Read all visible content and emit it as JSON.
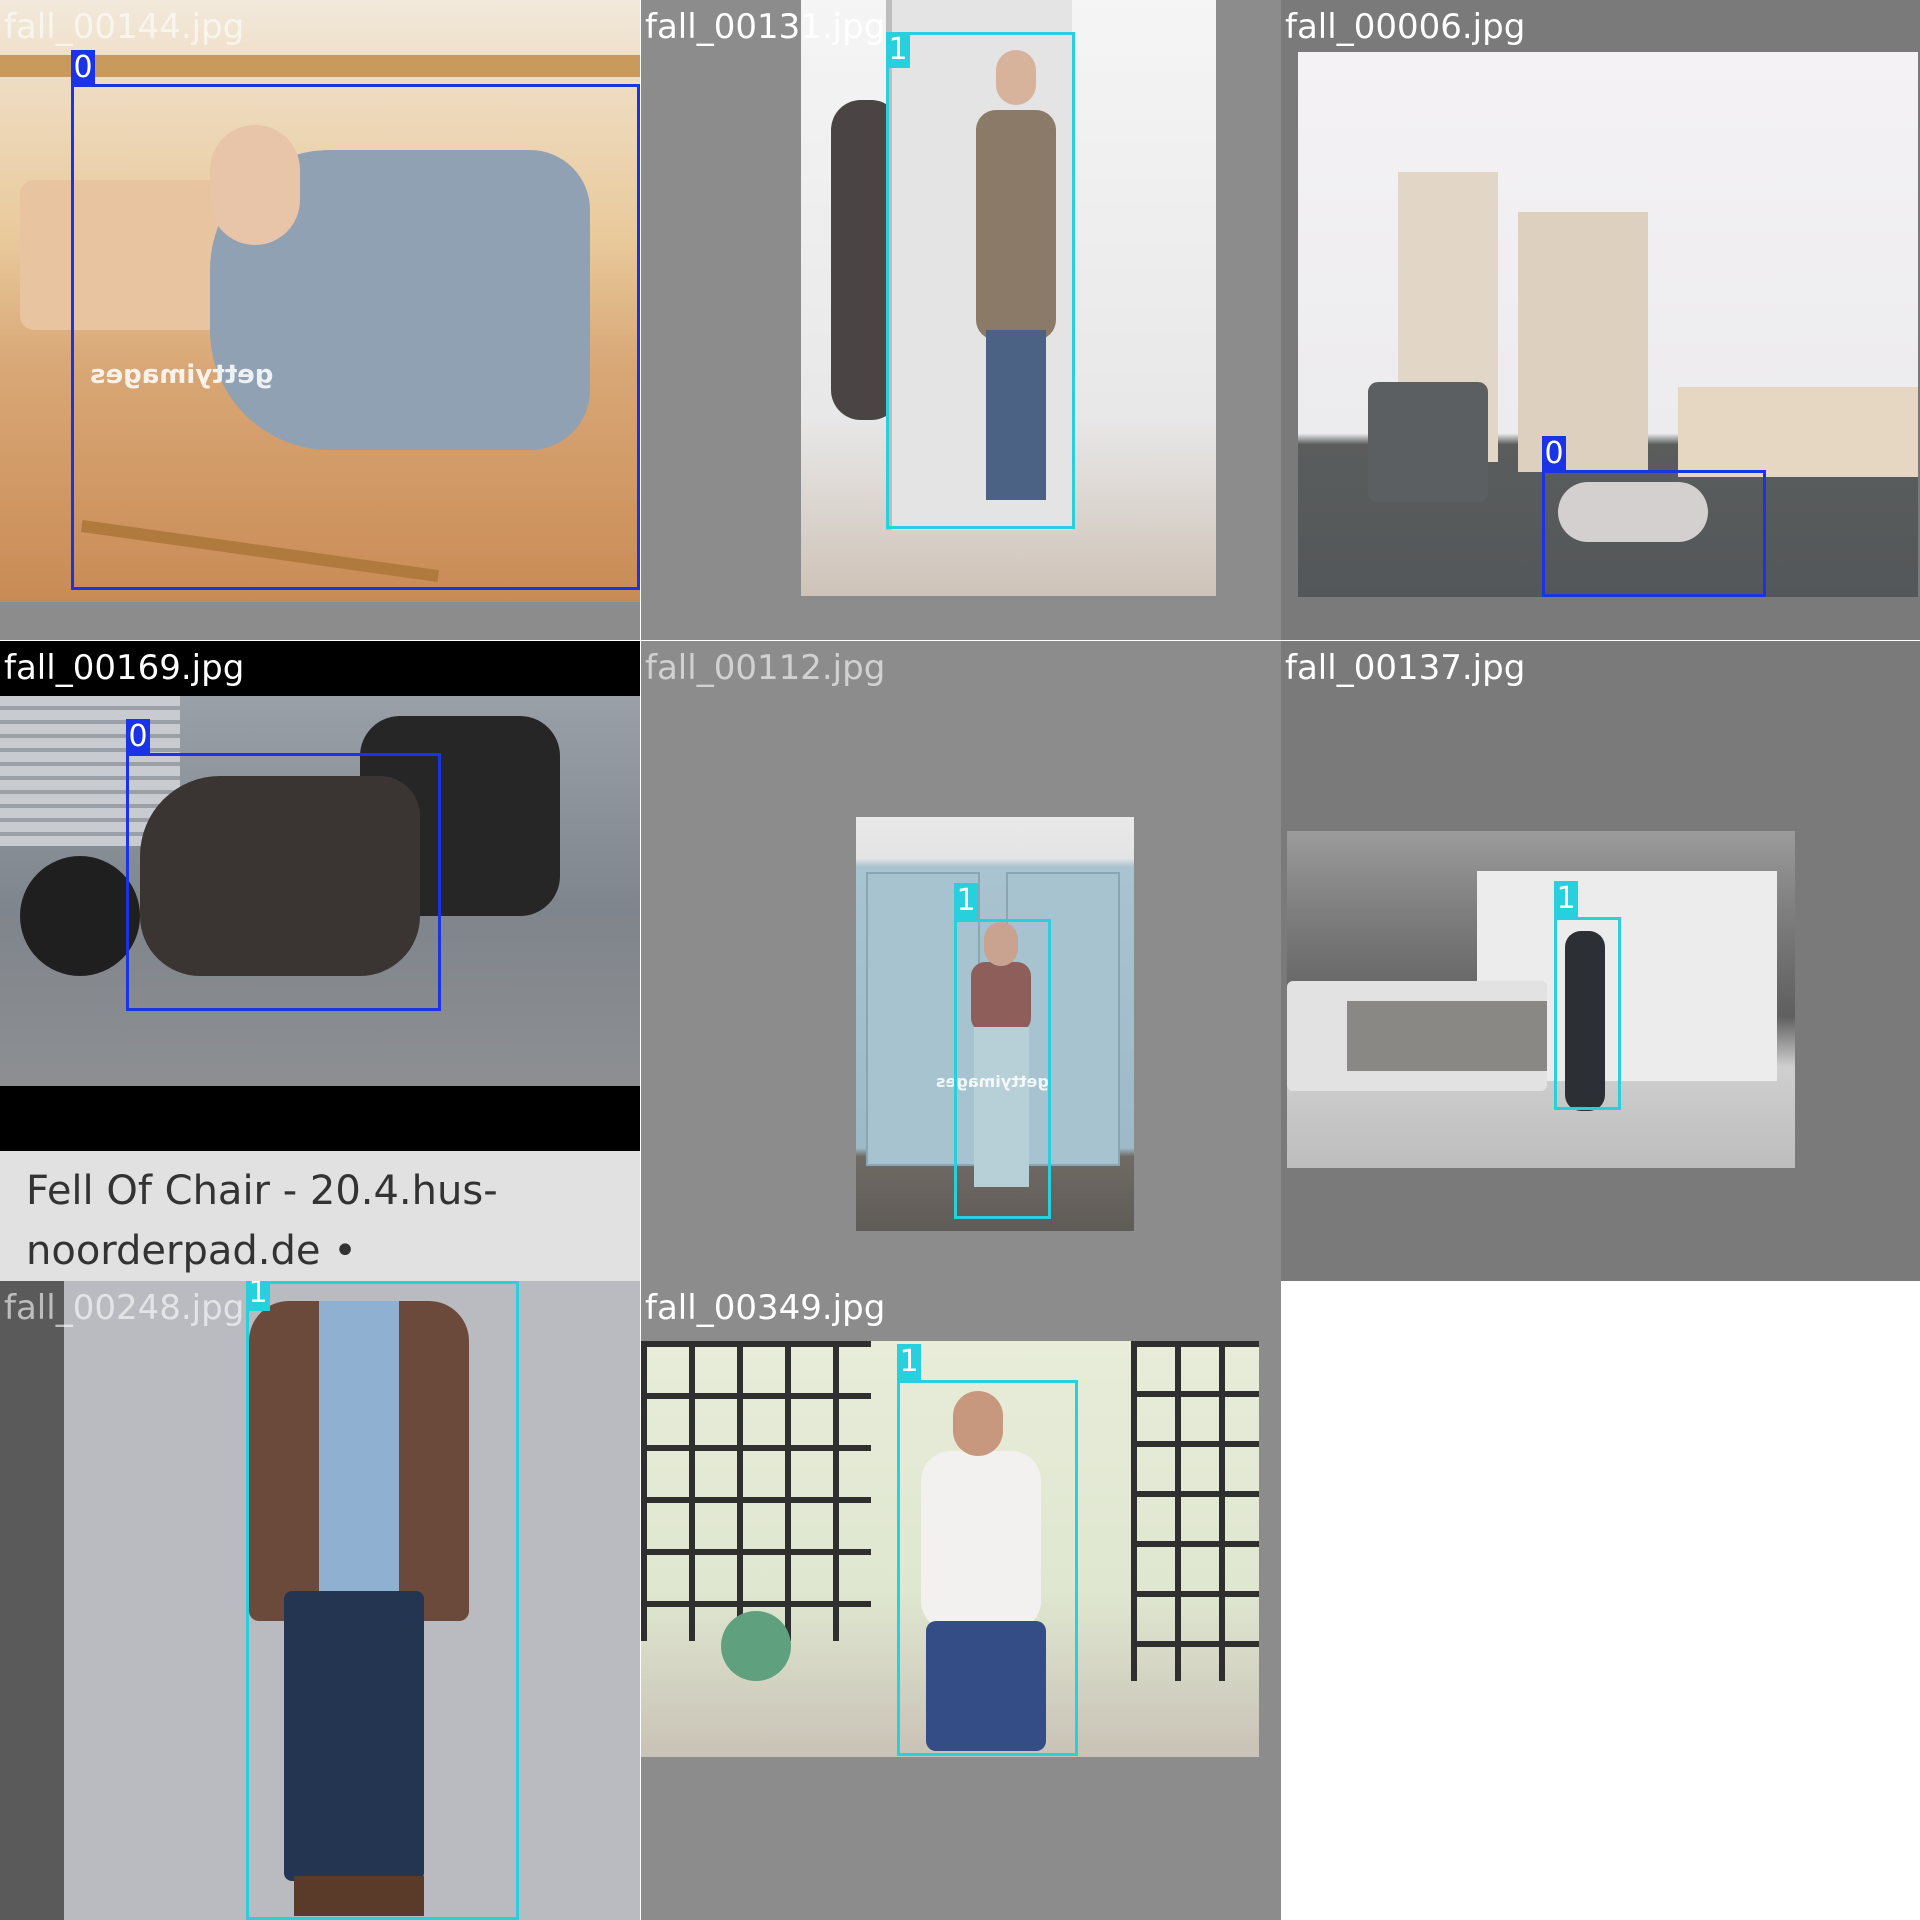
{
  "tiles": [
    {
      "file_name": "fall_00144.jpg",
      "detections": [
        {
          "class_id": "0",
          "class_color": "#1a33e6"
        }
      ]
    },
    {
      "file_name": "fall_00131.jpg",
      "detections": [
        {
          "class_id": "1",
          "class_color": "#27d0dc"
        }
      ]
    },
    {
      "file_name": "fall_00006.jpg",
      "detections": [
        {
          "class_id": "0",
          "class_color": "#1a33e6"
        }
      ]
    },
    {
      "file_name": "fall_00169.jpg",
      "caption_line1": "Fell Of Chair - 20.4.hus-",
      "caption_line2": "noorderpad.de •",
      "detections": [
        {
          "class_id": "0",
          "class_color": "#1a33e6"
        }
      ]
    },
    {
      "file_name": "fall_00112.jpg",
      "detections": [
        {
          "class_id": "1",
          "class_color": "#27d0dc"
        }
      ]
    },
    {
      "file_name": "fall_00137.jpg",
      "detections": [
        {
          "class_id": "1",
          "class_color": "#27d0dc"
        }
      ]
    },
    {
      "file_name": "fall_00248.jpg",
      "detections": [
        {
          "class_id": "1",
          "class_color": "#27d0dc"
        }
      ]
    },
    {
      "file_name": "fall_00349.jpg",
      "detections": [
        {
          "class_id": "1",
          "class_color": "#27d0dc"
        }
      ]
    }
  ],
  "colors": {
    "class_0": "#1a33e6",
    "class_1": "#27d0dc",
    "letterbox": "#8c8c8c"
  }
}
